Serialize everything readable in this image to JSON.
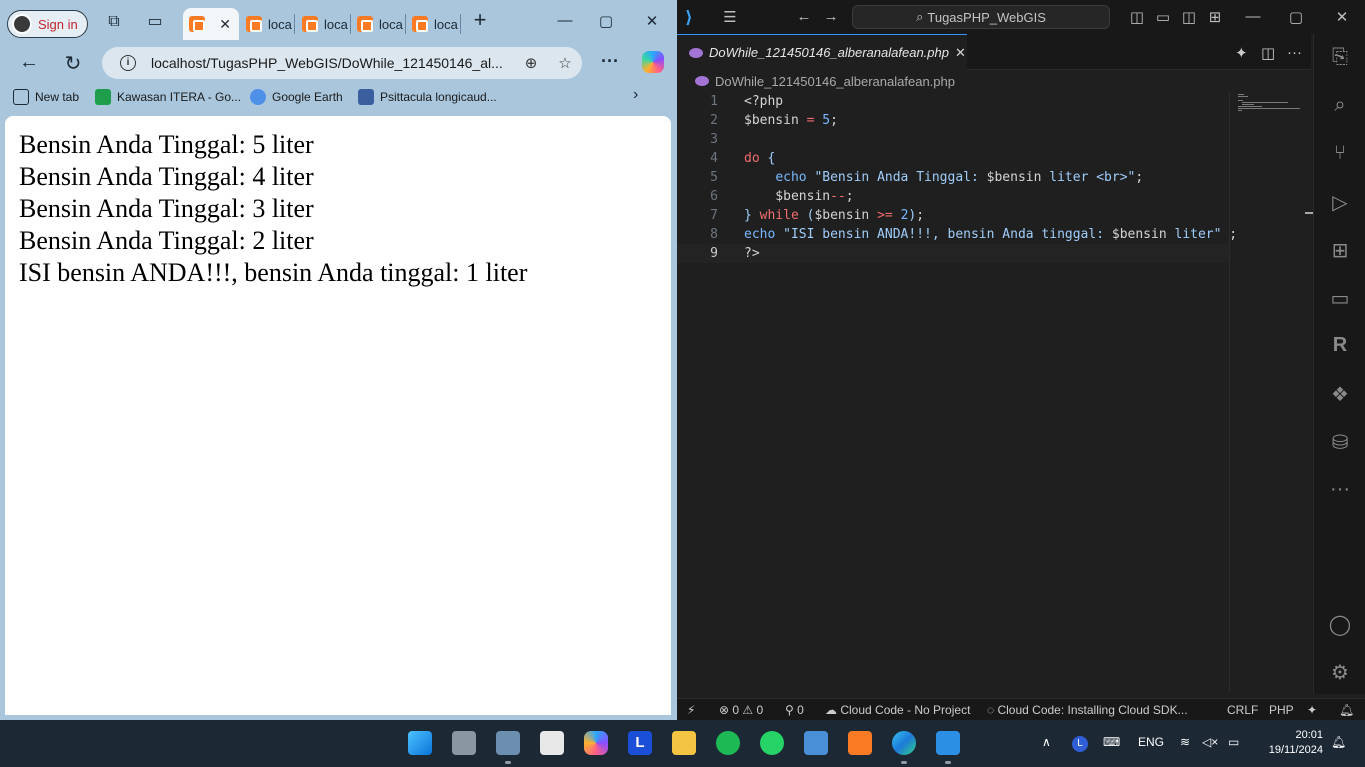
{
  "browser": {
    "signin_label": "Sign in",
    "tabs": [
      {
        "label": ""
      },
      {
        "label": "local"
      },
      {
        "label": "local"
      },
      {
        "label": "local"
      },
      {
        "label": "loca"
      }
    ],
    "url": "localhost/TugasPHP_WebGIS/DoWhile_121450146_al...",
    "bookmarks": [
      {
        "label": "New tab",
        "icon": "new-tab-icon"
      },
      {
        "label": "Kawasan ITERA - Go...",
        "icon": "itera-icon",
        "color": "#1e9e4a"
      },
      {
        "label": "Google Earth",
        "icon": "google-earth-icon",
        "color": "#4e8fe8"
      },
      {
        "label": "Psittacula longicaud...",
        "icon": "bird-icon",
        "color": "#3a5e9e"
      }
    ],
    "page_lines": [
      "Bensin Anda Tinggal: 5 liter",
      "Bensin Anda Tinggal: 4 liter",
      "Bensin Anda Tinggal: 3 liter",
      "Bensin Anda Tinggal: 2 liter",
      "ISI bensin ANDA!!!, bensin Anda tinggal: 1 liter"
    ]
  },
  "vscode": {
    "search_label": "TugasPHP_WebGIS",
    "tab_label": "DoWhile_121450146_alberanalafean.php",
    "breadcrumb": "DoWhile_121450146_alberanalafean.php",
    "line_numbers": [
      "1",
      "2",
      "3",
      "4",
      "5",
      "6",
      "7",
      "8",
      "9"
    ],
    "status": {
      "errors": "0",
      "warnings": "0",
      "ports": "0",
      "cloud_code": "Cloud Code - No Project",
      "installing": "Cloud Code: Installing Cloud SDK...",
      "eol": "CRLF",
      "language": "PHP"
    }
  },
  "taskbar": {
    "language": "ENG",
    "time": "20:01",
    "date": "19/11/2024"
  }
}
